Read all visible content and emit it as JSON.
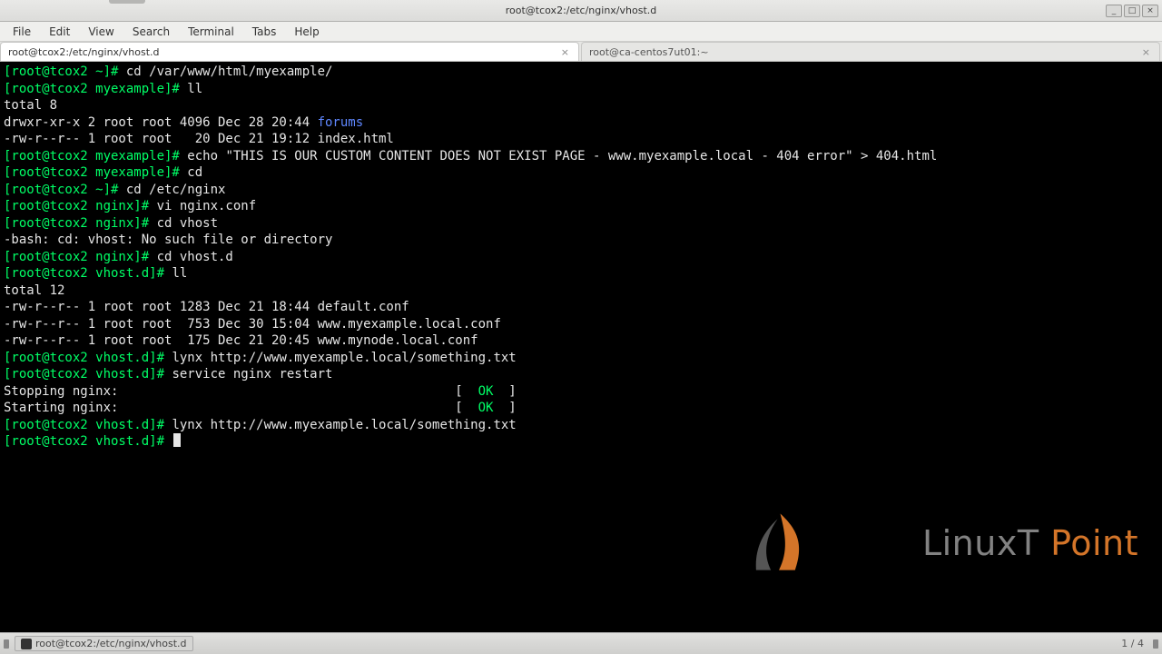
{
  "window": {
    "title": "root@tcox2:/etc/nginx/vhost.d"
  },
  "window_controls": {
    "min": "_",
    "max": "□",
    "close": "×"
  },
  "menubar": [
    "File",
    "Edit",
    "View",
    "Search",
    "Terminal",
    "Tabs",
    "Help"
  ],
  "tabs": [
    {
      "label": "root@tcox2:/etc/nginx/vhost.d",
      "active": true
    },
    {
      "label": "root@ca-centos7ut01:~",
      "active": false
    }
  ],
  "terminal_lines": [
    {
      "segs": [
        {
          "c": "g",
          "t": "[root@tcox2 ~]# "
        },
        {
          "c": "w",
          "t": "cd /var/www/html/myexample/"
        }
      ]
    },
    {
      "segs": [
        {
          "c": "g",
          "t": "[root@tcox2 myexample]# "
        },
        {
          "c": "w",
          "t": "ll"
        }
      ]
    },
    {
      "segs": [
        {
          "c": "w",
          "t": "total 8"
        }
      ]
    },
    {
      "segs": [
        {
          "c": "w",
          "t": "drwxr-xr-x 2 root root 4096 Dec 28 20:44 "
        },
        {
          "c": "bl",
          "t": "forums"
        }
      ]
    },
    {
      "segs": [
        {
          "c": "w",
          "t": "-rw-r--r-- 1 root root   20 Dec 21 19:12 index.html"
        }
      ]
    },
    {
      "segs": [
        {
          "c": "g",
          "t": "[root@tcox2 myexample]# "
        },
        {
          "c": "w",
          "t": "echo \"THIS IS OUR CUSTOM CONTENT DOES NOT EXIST PAGE - www.myexample.local - 404 error\" > 404.html"
        }
      ]
    },
    {
      "segs": [
        {
          "c": "g",
          "t": "[root@tcox2 myexample]# "
        },
        {
          "c": "w",
          "t": "cd"
        }
      ]
    },
    {
      "segs": [
        {
          "c": "g",
          "t": "[root@tcox2 ~]# "
        },
        {
          "c": "w",
          "t": "cd /etc/nginx"
        }
      ]
    },
    {
      "segs": [
        {
          "c": "g",
          "t": "[root@tcox2 nginx]# "
        },
        {
          "c": "w",
          "t": "vi nginx.conf"
        }
      ]
    },
    {
      "segs": [
        {
          "c": "g",
          "t": "[root@tcox2 nginx]# "
        },
        {
          "c": "w",
          "t": "cd vhost"
        }
      ]
    },
    {
      "segs": [
        {
          "c": "w",
          "t": "-bash: cd: vhost: No such file or directory"
        }
      ]
    },
    {
      "segs": [
        {
          "c": "g",
          "t": "[root@tcox2 nginx]# "
        },
        {
          "c": "w",
          "t": "cd vhost.d"
        }
      ]
    },
    {
      "segs": [
        {
          "c": "g",
          "t": "[root@tcox2 vhost.d]# "
        },
        {
          "c": "w",
          "t": "ll"
        }
      ]
    },
    {
      "segs": [
        {
          "c": "w",
          "t": "total 12"
        }
      ]
    },
    {
      "segs": [
        {
          "c": "w",
          "t": "-rw-r--r-- 1 root root 1283 Dec 21 18:44 default.conf"
        }
      ]
    },
    {
      "segs": [
        {
          "c": "w",
          "t": "-rw-r--r-- 1 root root  753 Dec 30 15:04 www.myexample.local.conf"
        }
      ]
    },
    {
      "segs": [
        {
          "c": "w",
          "t": "-rw-r--r-- 1 root root  175 Dec 21 20:45 www.mynode.local.conf"
        }
      ]
    },
    {
      "segs": [
        {
          "c": "g",
          "t": "[root@tcox2 vhost.d]# "
        },
        {
          "c": "w",
          "t": "lynx http://www.myexample.local/something.txt"
        }
      ]
    },
    {
      "segs": [
        {
          "c": "g",
          "t": "[root@tcox2 vhost.d]# "
        },
        {
          "c": "w",
          "t": "service nginx restart"
        }
      ]
    },
    {
      "segs": [
        {
          "c": "w",
          "t": "Stopping nginx:                                            [  "
        },
        {
          "c": "g",
          "t": "OK"
        },
        {
          "c": "w",
          "t": "  ]"
        }
      ]
    },
    {
      "segs": [
        {
          "c": "w",
          "t": "Starting nginx:                                            [  "
        },
        {
          "c": "g",
          "t": "OK"
        },
        {
          "c": "w",
          "t": "  ]"
        }
      ]
    },
    {
      "segs": [
        {
          "c": "g",
          "t": "[root@tcox2 vhost.d]# "
        },
        {
          "c": "w",
          "t": "lynx http://www.myexample.local/something.txt"
        }
      ]
    },
    {
      "segs": [
        {
          "c": "g",
          "t": "[root@tcox2 vhost.d]# "
        }
      ],
      "cursor": true
    }
  ],
  "watermark": {
    "text_a": "LinuxT ",
    "text_b": "Point"
  },
  "taskbar": {
    "app_label": "root@tcox2:/etc/nginx/vhost.d",
    "pager": "1 / 4"
  }
}
